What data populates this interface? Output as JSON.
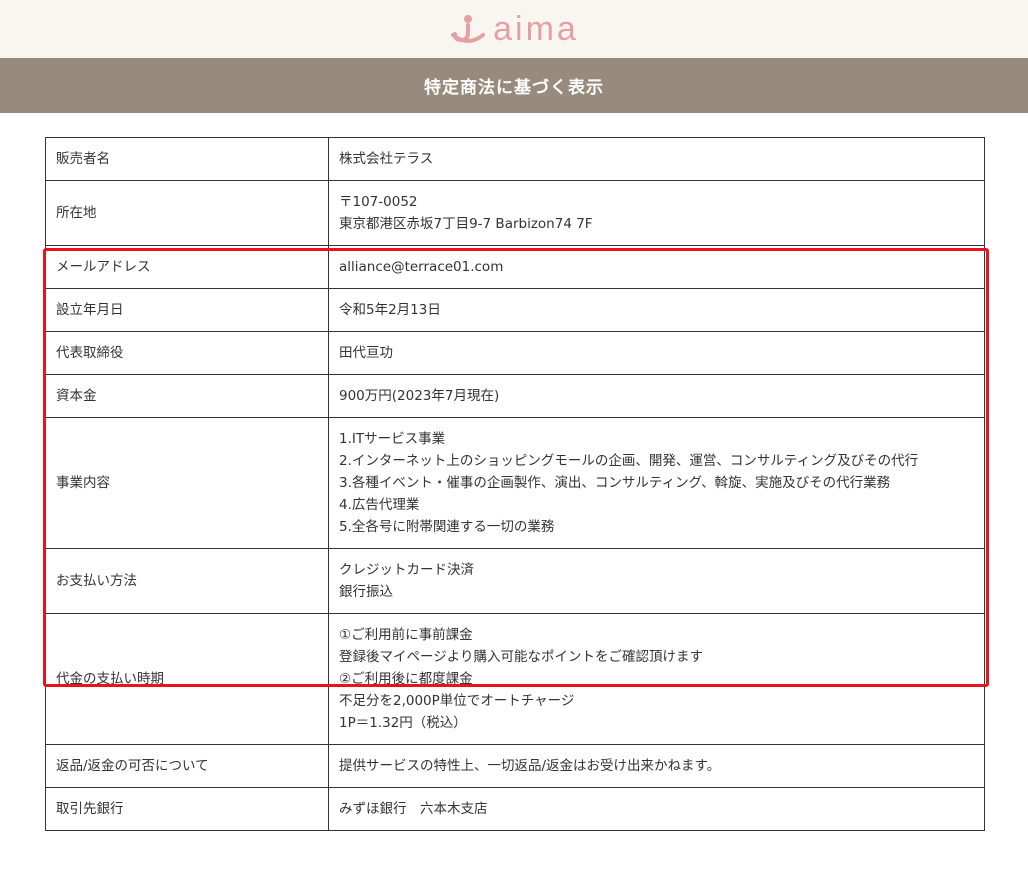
{
  "header": {
    "logo_text": "aima"
  },
  "page_title": "特定商法に基づく表示",
  "rows": [
    {
      "label": "販売者名",
      "value": [
        "株式会社テラス"
      ]
    },
    {
      "label": "所在地",
      "value": [
        "〒107-0052",
        "東京都港区赤坂7丁目9-7 Barbizon74 7F"
      ]
    },
    {
      "label": "メールアドレス",
      "value": [
        "alliance@terrace01.com"
      ]
    },
    {
      "label": "設立年月日",
      "value": [
        "令和5年2月13日"
      ]
    },
    {
      "label": "代表取締役",
      "value": [
        "田代亘功"
      ]
    },
    {
      "label": "資本金",
      "value": [
        "900万円(2023年7月現在)"
      ]
    },
    {
      "label": "事業内容",
      "value": [
        "1.ITサービス事業",
        "2.インターネット上のショッピングモールの企画、開発、運営、コンサルティング及びその代行",
        "3.各種イベント・催事の企画製作、演出、コンサルティング、斡旋、実施及びその代行業務",
        "4.広告代理業",
        "5.全各号に附帯関連する一切の業務"
      ]
    },
    {
      "label": "お支払い方法",
      "value": [
        "クレジットカード決済",
        "銀行振込"
      ]
    },
    {
      "label": "代金の支払い時期",
      "value": [
        "①ご利用前に事前課金",
        "登録後マイページより購入可能なポイントをご確認頂けます",
        "②ご利用後に都度課金",
        "不足分を2,000P単位でオートチャージ",
        "1P＝1.32円（税込）"
      ]
    },
    {
      "label": "返品/返金の可否について",
      "value": [
        "提供サービスの特性上、一切返品/返金はお受け出来かねます。"
      ]
    },
    {
      "label": "取引先銀行",
      "value": [
        "みずほ銀行　六本木支店"
      ]
    }
  ],
  "colors": {
    "title_bar": "#988b7d",
    "top_bar": "#f8f6f1",
    "logo": "#e6a0a4",
    "highlight": "#e8131b"
  }
}
